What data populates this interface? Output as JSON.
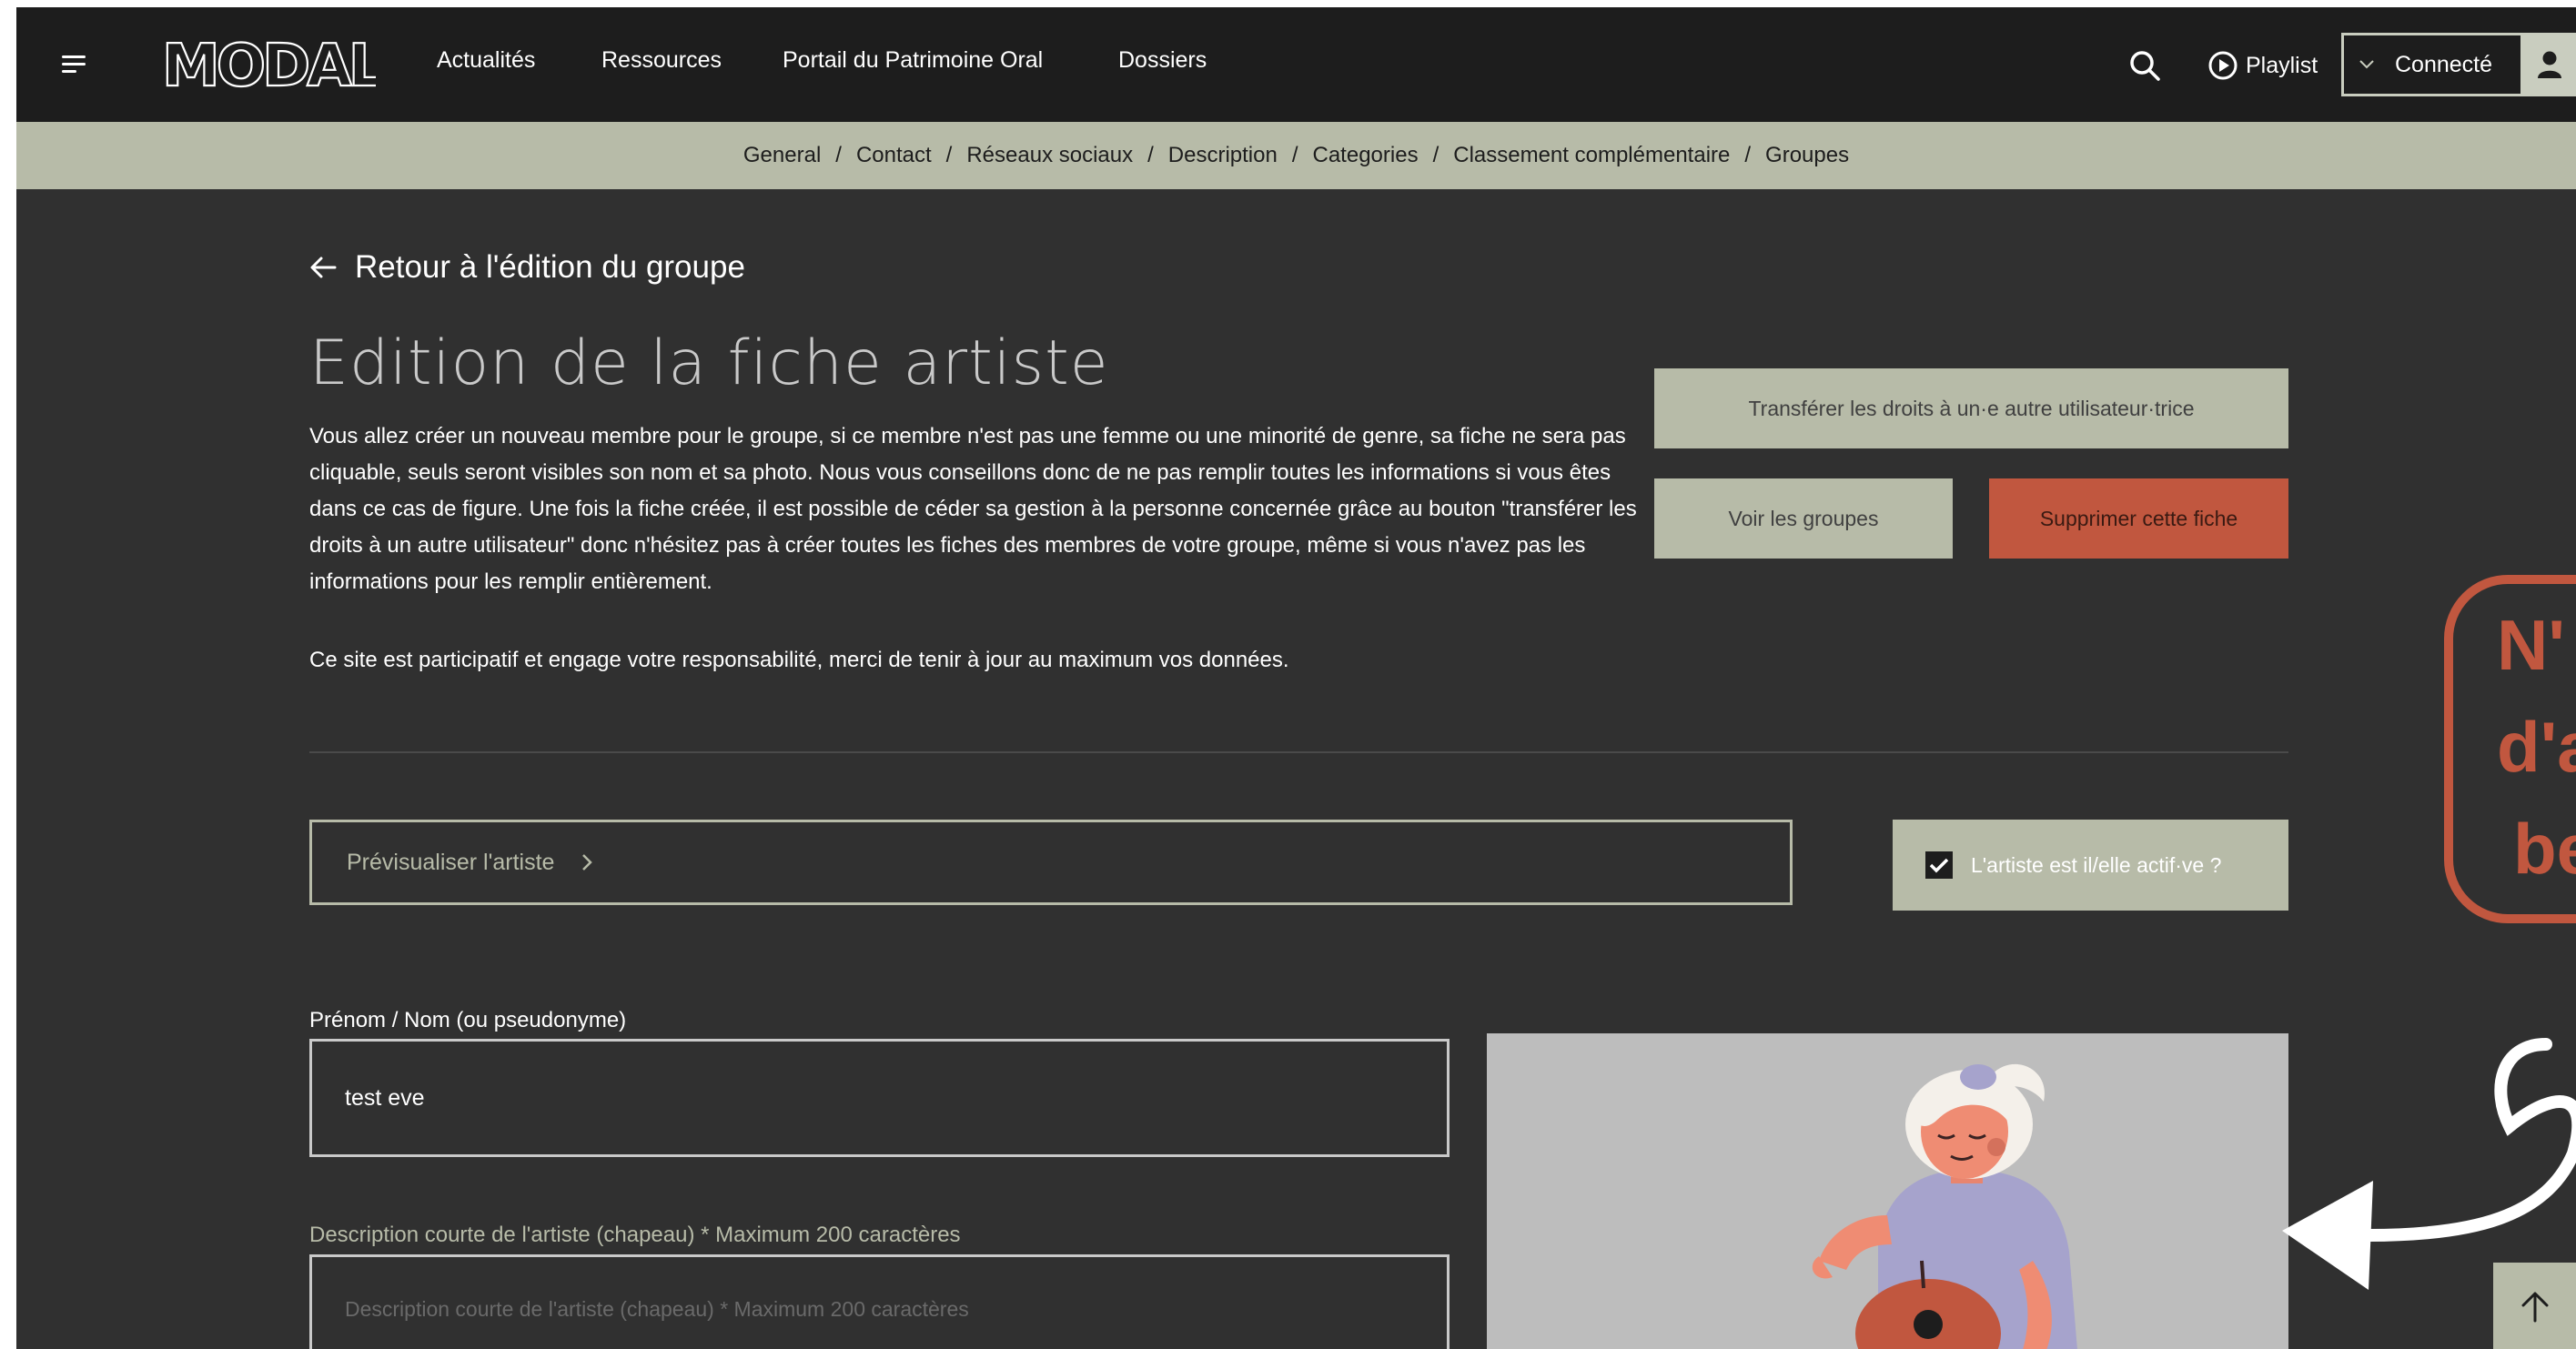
{
  "brand": {
    "logo_text": "MODAL"
  },
  "nav": {
    "links": [
      "Actualités",
      "Ressources",
      "Portail du Patrimoine Oral",
      "Dossiers"
    ],
    "playlist_label": "Playlist",
    "account_label": "Connecté"
  },
  "subnav": {
    "items": [
      "General",
      "Contact",
      "Réseaux sociaux",
      "Description",
      "Categories",
      "Classement complémentaire",
      "Groupes"
    ],
    "separator": "/"
  },
  "page": {
    "back_label": "Retour à l'édition du groupe",
    "title": "Edition de la fiche artiste",
    "intro": "Vous allez créer un nouveau membre pour le groupe, si ce membre n'est pas une femme ou une minorité de genre, sa fiche ne sera pas cliquable, seuls seront visibles son nom et sa photo. Nous vous conseillons donc de ne pas remplir toutes les informations si vous êtes dans ce cas de figure. Une fois la fiche créée, il est possible de céder sa gestion à la personne concernée grâce au bouton \"transférer les droits à un autre utilisateur\" donc n'hésitez pas à créer toutes les fiches des membres de votre groupe, même si vous n'avez pas les informations pour les remplir entièrement.",
    "participatif": "Ce site est participatif et engage votre responsabilité, merci de tenir à jour au maximum vos données."
  },
  "actions": {
    "transfer_label": "Transférer les droits à un·e autre utilisateur·trice",
    "groups_label": "Voir les groupes",
    "delete_label": "Supprimer cette fiche",
    "preview_label": "Prévisualiser l'artiste",
    "active_label": "L'artiste est il/elle actif·ve ?",
    "active_checked": true
  },
  "form": {
    "name_label": "Prénom / Nom (ou pseudonyme)",
    "name_value": "test eve",
    "desc_label": "Description courte de l'artiste (chapeau) * Maximum 200 caractères",
    "desc_placeholder": "Description courte de l'artiste (chapeau) * Maximum 200 caractères"
  },
  "promo": {
    "lines": [
      "N'",
      "d'a",
      "be"
    ]
  },
  "colors": {
    "page_bg": "#303030",
    "topbar_bg": "#1d1d1d",
    "sage": "#b7bba8",
    "danger": "#c1573f",
    "photo_bg": "#bdbdbd"
  },
  "icons": [
    "menu-icon",
    "search-icon",
    "play-circle-icon",
    "chevron-down-icon",
    "user-icon",
    "arrow-left-icon",
    "chevron-right-icon",
    "checkmark-icon",
    "arrow-up-icon"
  ]
}
